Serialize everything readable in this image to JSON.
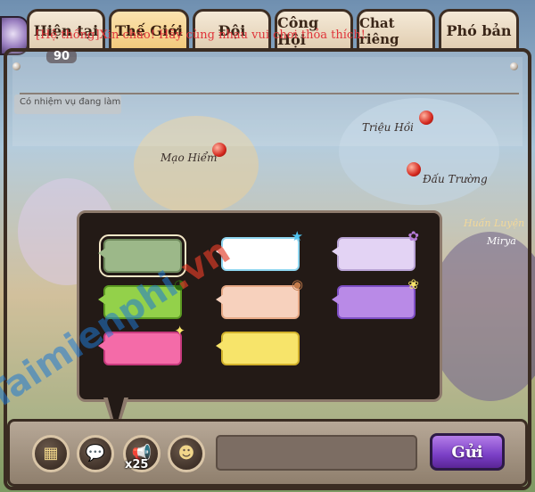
{
  "tabs": [
    {
      "label": "Hiện tại",
      "active": false
    },
    {
      "label": "Thế Giới",
      "active": true
    },
    {
      "label": "Đội",
      "active": false
    },
    {
      "label": "Công Hội",
      "active": false
    },
    {
      "label": "Chat riêng",
      "active": false
    },
    {
      "label": "Phó bản",
      "active": false
    }
  ],
  "chat": {
    "system_message": "[Hệ thống]Xin chào! Hãy cùng nhau vui chơi thỏa thích!"
  },
  "background": {
    "level": "90",
    "quest_tag": "Có nhiệm vụ đang làm",
    "labels": {
      "trieu_hoi": "Triệu Hồi",
      "mao_hiem": "Mạo Hiểm",
      "dau_truong": "Đấu Trường",
      "huan_luyen": "Huấn Luyện",
      "mirya": "Mirya"
    }
  },
  "bubble_picker": {
    "selected_index": 0,
    "bubbles": [
      {
        "name": "green-dark",
        "color": "#9cb889",
        "border": "#6f8a5d",
        "deco": ""
      },
      {
        "name": "white-star",
        "color": "#ffffff",
        "border": "#8fd6f0",
        "deco": "star-icon"
      },
      {
        "name": "lavender-bow",
        "color": "#e3d3f4",
        "border": "#b9a4d6",
        "deco": "bow-icon"
      },
      {
        "name": "lime-frog",
        "color": "#93d14a",
        "border": "#5c9a22",
        "deco": "frog-icon"
      },
      {
        "name": "peach-cat",
        "color": "#f7d1bd",
        "border": "#e7a986",
        "deco": "cat-icon"
      },
      {
        "name": "purple-flower",
        "color": "#b98ae7",
        "border": "#7d4ec4",
        "deco": "flower-icon"
      },
      {
        "name": "pink-stripe",
        "color": "#f46ba8",
        "border": "#c63a7d",
        "deco": "leaf-icon"
      },
      {
        "name": "yellow",
        "color": "#f7e46a",
        "border": "#d1b12c",
        "deco": ""
      }
    ]
  },
  "toolbar": {
    "emoji_count_label": "x25",
    "input_value": "",
    "send_label": "Gửi"
  },
  "watermark": {
    "part1": "Taimienphi",
    "part2": ".vn"
  }
}
